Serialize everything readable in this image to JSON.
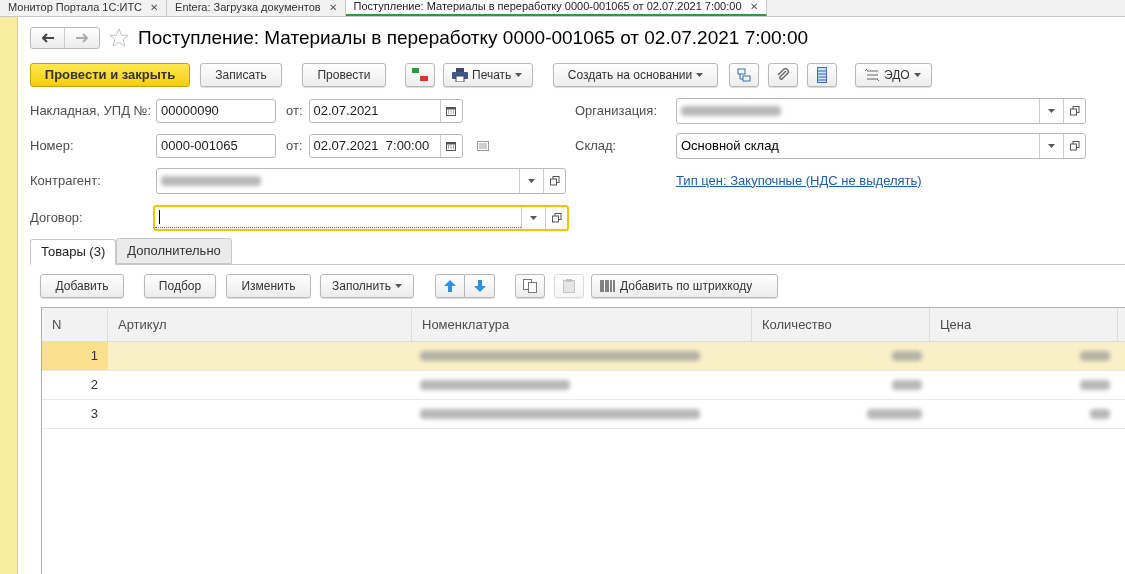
{
  "window_tabs": [
    {
      "label": "Монитор Портала 1С:ИТС",
      "selected": false,
      "close": "✕"
    },
    {
      "label": "Entera: Загрузка документов",
      "selected": false,
      "close": "✕"
    },
    {
      "label": "Поступление: Материалы в переработку 0000-001065 от 02.07.2021 7:00:00",
      "selected": true,
      "close": "✕"
    }
  ],
  "title": "Поступление: Материалы в переработку 0000-001065 от 02.07.2021 7:00:00",
  "toolbar": {
    "post_close": "Провести и закрыть",
    "write": "Записать",
    "post": "Провести",
    "print": "Печать",
    "create_based": "Создать на основании",
    "edo": "ЭДО"
  },
  "invoice": {
    "label": "Накладная, УПД №:",
    "value": "00000090",
    "date_label": "от:",
    "date": "02.07.2021"
  },
  "number": {
    "label": "Номер:",
    "value": "0000-001065",
    "date_label": "от:",
    "date": "02.07.2021  7:00:00"
  },
  "counterparty": {
    "label": "Контрагент:",
    "redacted": true
  },
  "contract": {
    "label": "Договор:",
    "focused": true,
    "required": true
  },
  "organization": {
    "label": "Организация:",
    "redacted": true
  },
  "warehouse": {
    "label": "Склад:",
    "value": "Основной склад"
  },
  "price_link": "Тип цен: Закупочные (НДС не выделять)",
  "tabs": [
    {
      "label": "Товары (3)",
      "selected": true
    },
    {
      "label": "Дополнительно",
      "selected": false
    }
  ],
  "table_toolbar": {
    "add": "Добавить",
    "pick": "Подбор",
    "edit": "Изменить",
    "fill": "Заполнить",
    "paste_disabled": true,
    "barcode": "Добавить по штрихкоду"
  },
  "table": {
    "columns": [
      "N",
      "Артикул",
      "Номенклатура",
      "Количество",
      "Цена"
    ],
    "rows": [
      {
        "n": "1",
        "selected": true,
        "redacted": true
      },
      {
        "n": "2",
        "selected": false,
        "redacted": true
      },
      {
        "n": "3",
        "selected": false,
        "redacted": true
      }
    ]
  }
}
